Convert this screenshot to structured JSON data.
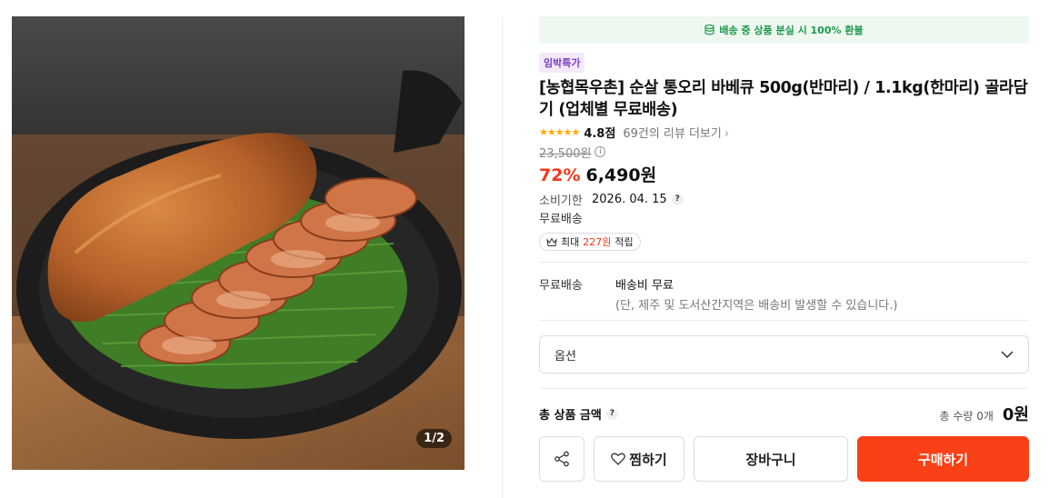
{
  "image": {
    "counter": "1/2",
    "description_icon": "product-photo"
  },
  "banner": {
    "icon": "coin-stack-icon",
    "text": "배송 중 상품 분실 시 100% 환불"
  },
  "product": {
    "badge": "임박특가",
    "title": "[농협목우촌] 순살 통오리 바베큐 500g(반마리) / 1.1kg(한마리) 골라담기 (업체별 무료배송)",
    "stars": "★★★★★",
    "rating": "4.8점",
    "review_link": "69건의 리뷰 더보기",
    "original_price": "23,500원",
    "discount": "72%",
    "price": "6,490원",
    "expiry_label": "소비기한",
    "expiry_value": "2026. 04. 15",
    "free_shipping": "무료배송",
    "points_prefix": "최대",
    "points_amount": "227원",
    "points_suffix": "적립"
  },
  "shipping": {
    "label": "무료배송",
    "fee": "배송비 무료",
    "note": "(단, 제주 및 도서산간지역은 배송비 발생할 수 있습니다.)"
  },
  "option": {
    "placeholder": "옵션"
  },
  "total": {
    "label": "총 상품 금액",
    "quantity": "총 수량 0개",
    "amount": "0원"
  },
  "buttons": {
    "wish": "찜하기",
    "cart": "장바구니",
    "buy": "구매하기"
  },
  "colors": {
    "accent": "#fa4016",
    "discount": "#f4361b",
    "banner_text": "#1f9a4c",
    "badge_text": "#7b3fc4"
  }
}
